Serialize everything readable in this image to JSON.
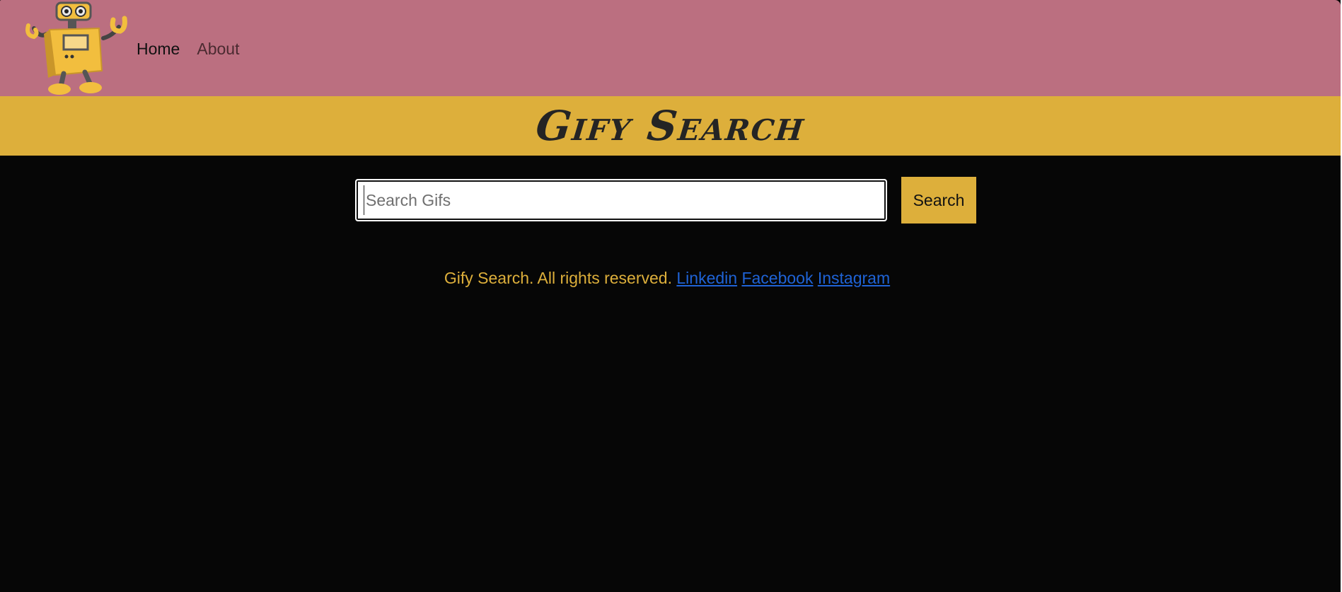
{
  "colors": {
    "navbar_bg": "#bb6f80",
    "banner_bg": "#ddaf3b",
    "page_bg": "#060606",
    "nav_active": "#111111",
    "nav_inactive": "#4a2a30",
    "button_bg": "#ddaf3b",
    "footer_text": "#ddaf3b",
    "link": "#1f63d6"
  },
  "navbar": {
    "logo_icon": "robot-icon",
    "links": [
      {
        "label": "Home",
        "active": true
      },
      {
        "label": "About",
        "active": false
      }
    ]
  },
  "banner": {
    "title": "Gify Search"
  },
  "search": {
    "placeholder": "Search Gifs",
    "value": "",
    "button_label": "Search"
  },
  "footer": {
    "text": "Gify Search. All rights reserved.",
    "links": [
      {
        "label": "Linkedin"
      },
      {
        "label": "Facebook"
      },
      {
        "label": "Instagram"
      }
    ]
  }
}
